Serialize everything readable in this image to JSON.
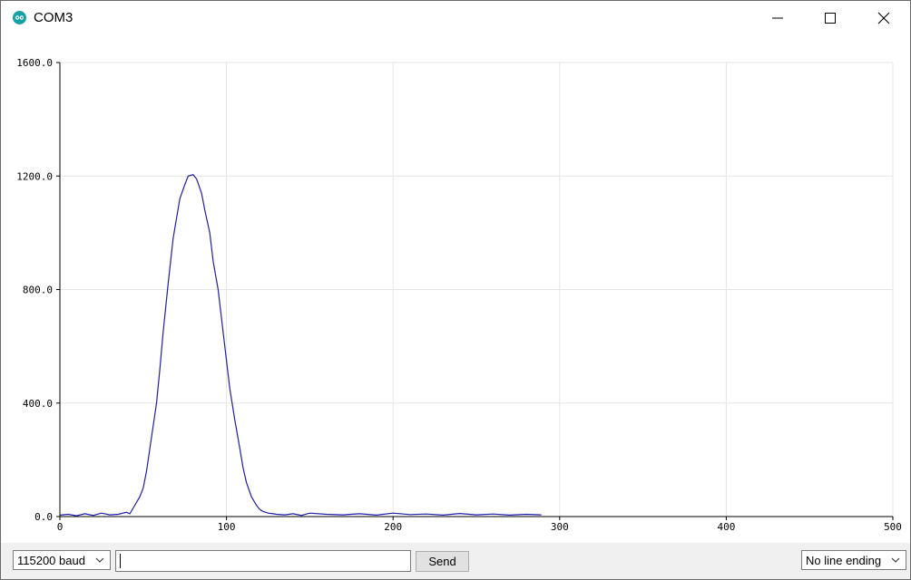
{
  "window": {
    "title": "COM3"
  },
  "icons": {
    "app": "arduino-logo-icon",
    "minimize": "minimize-icon",
    "maximize": "maximize-icon",
    "close": "close-icon",
    "dropdown": "chevron-down-icon"
  },
  "colors": {
    "series": "#1f1fa8",
    "grid": "#e6e6e6",
    "logo": "#17a1a5"
  },
  "chart_data": {
    "type": "line",
    "xlim": [
      0,
      500
    ],
    "ylim": [
      0,
      1600
    ],
    "xticks": [
      0,
      100,
      200,
      300,
      400,
      500
    ],
    "xtick_labels": [
      "0",
      "100",
      "200",
      "300",
      "400",
      "500"
    ],
    "yticks": [
      0,
      400,
      800,
      1200,
      1600
    ],
    "ytick_labels": [
      "0.0",
      "400.0",
      "800.0",
      "1200.0",
      "1600.0"
    ],
    "grid": true,
    "series": [
      {
        "x": [
          0,
          5,
          10,
          15,
          20,
          25,
          30,
          35,
          40,
          42,
          45,
          48,
          50,
          52,
          55,
          58,
          60,
          62,
          65,
          68,
          70,
          72,
          75,
          77,
          80,
          82,
          85,
          87,
          90,
          92,
          95,
          98,
          100,
          102,
          105,
          108,
          110,
          112,
          115,
          118,
          120,
          122,
          125,
          128,
          130,
          135,
          140,
          145,
          150,
          160,
          170,
          180,
          190,
          200,
          210,
          220,
          230,
          240,
          250,
          260,
          270,
          280,
          289
        ],
        "y": [
          5,
          8,
          3,
          10,
          4,
          12,
          6,
          8,
          15,
          10,
          40,
          70,
          100,
          160,
          280,
          400,
          520,
          650,
          820,
          980,
          1050,
          1120,
          1170,
          1200,
          1205,
          1190,
          1140,
          1080,
          1000,
          900,
          800,
          650,
          550,
          450,
          340,
          240,
          170,
          120,
          70,
          40,
          25,
          18,
          12,
          10,
          8,
          6,
          10,
          4,
          12,
          8,
          6,
          10,
          5,
          12,
          7,
          9,
          5,
          11,
          6,
          9,
          5,
          8,
          6
        ]
      }
    ]
  },
  "bottom": {
    "baud": "115200 baud",
    "input_value": "",
    "send_label": "Send",
    "line_ending": "No line ending"
  }
}
